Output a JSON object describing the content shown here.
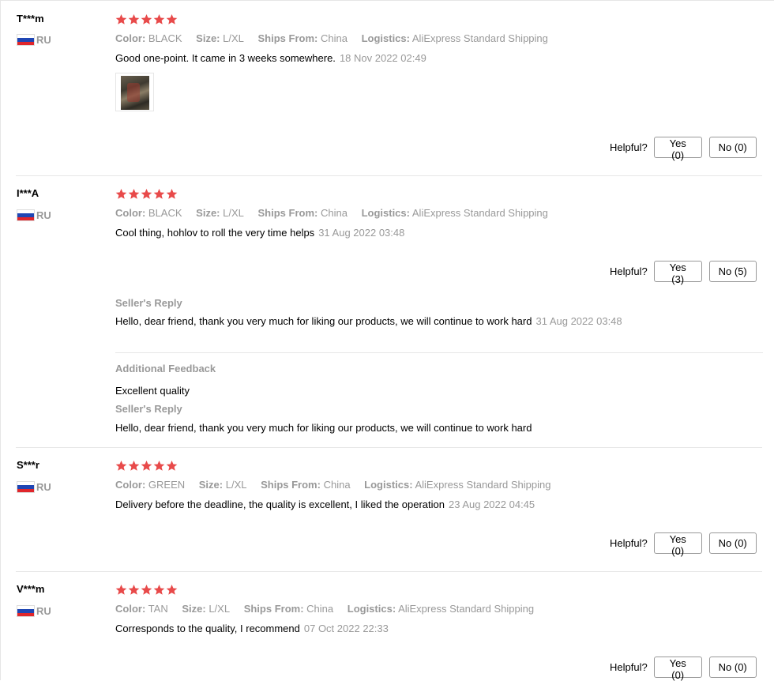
{
  "labels": {
    "color": "Color:",
    "size": "Size:",
    "ships_from": "Ships From:",
    "logistics": "Logistics:",
    "helpful": "Helpful?",
    "seller_reply": "Seller's Reply",
    "additional_feedback": "Additional Feedback"
  },
  "colors": {
    "star": "#e84a4a",
    "muted": "#999999",
    "separator": "#e6e6e6"
  },
  "reviews": [
    {
      "user": "T***m",
      "country": "RU",
      "stars": 5,
      "color": "BLACK",
      "size": "L/XL",
      "ships_from": "China",
      "logistics": "AliExpress Standard Shipping",
      "text": "Good one-point. It came in 3 weeks somewhere.",
      "date": "18 Nov 2022 02:49",
      "yes": "Yes (0)",
      "no": "No (0)"
    },
    {
      "user": "I***A",
      "country": "RU",
      "stars": 5,
      "color": "BLACK",
      "size": "L/XL",
      "ships_from": "China",
      "logistics": "AliExpress Standard Shipping",
      "text": "Cool thing, hohlov to roll the very time helps",
      "date": "31 Aug 2022 03:48",
      "yes": "Yes (3)",
      "no": "No (5)",
      "seller_reply": {
        "text": "Hello, dear friend, thank you very much for liking our products, we will continue to work hard",
        "date": "31 Aug 2022 03:48"
      },
      "additional": {
        "text": "Excellent quality",
        "reply": "Hello, dear friend, thank you very much for liking our products, we will continue to work hard"
      }
    },
    {
      "user": "S***r",
      "country": "RU",
      "stars": 5,
      "color": "GREEN",
      "size": "L/XL",
      "ships_from": "China",
      "logistics": "AliExpress Standard Shipping",
      "text": "Delivery before the deadline, the quality is excellent, I liked the operation",
      "date": "23 Aug 2022 04:45",
      "yes": "Yes (0)",
      "no": "No (0)"
    },
    {
      "user": "V***m",
      "country": "RU",
      "stars": 5,
      "color": "TAN",
      "size": "L/XL",
      "ships_from": "China",
      "logistics": "AliExpress Standard Shipping",
      "text": "Corresponds to the quality, I recommend",
      "date": "07 Oct 2022 22:33",
      "yes": "Yes (0)",
      "no": "No (0)"
    }
  ]
}
